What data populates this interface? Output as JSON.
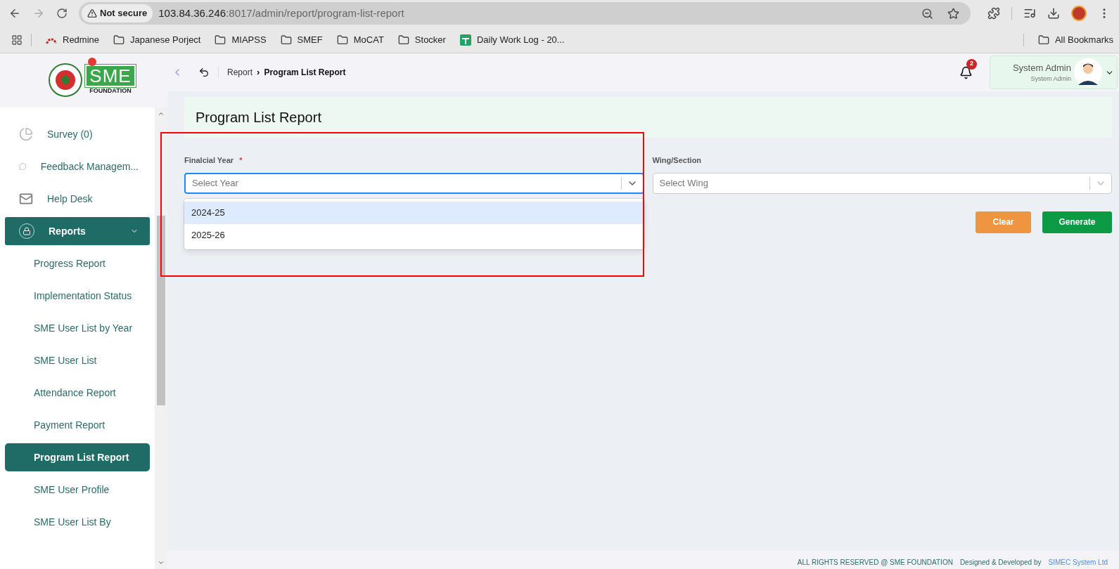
{
  "browser": {
    "security": "Not secure",
    "url_host": "103.84.36.246",
    "url_rest": ":8017/admin/report/program-list-report",
    "bookmarks": [
      {
        "label": "Redmine",
        "kind": "redmine"
      },
      {
        "label": "Japanese Porject",
        "kind": "folder"
      },
      {
        "label": "MIAPSS",
        "kind": "folder"
      },
      {
        "label": "SMEF",
        "kind": "folder"
      },
      {
        "label": "MoCAT",
        "kind": "folder"
      },
      {
        "label": "Stocker",
        "kind": "folder"
      },
      {
        "label": "Daily Work Log - 20...",
        "kind": "sheet"
      }
    ],
    "all_bookmarks": "All Bookmarks"
  },
  "logo": {
    "letters": "SME",
    "subtitle": "FOUNDATION"
  },
  "breadcrumb": {
    "parent": "Report",
    "separator": "›",
    "current": "Program List Report"
  },
  "notifications": {
    "count": "2"
  },
  "user": {
    "name": "System Admin",
    "role": "System Admin"
  },
  "sidebar": {
    "items": [
      {
        "label": "Survey (0)",
        "selected": false
      },
      {
        "label": "Feedback Managem...",
        "selected": false
      },
      {
        "label": "Help Desk",
        "selected": false
      },
      {
        "label": "Reports",
        "selected": true,
        "expanded": true,
        "children": [
          {
            "label": "Progress Report",
            "selected": false
          },
          {
            "label": "Implementation Status",
            "selected": false
          },
          {
            "label": "SME User List by Year",
            "selected": false
          },
          {
            "label": "SME User List",
            "selected": false
          },
          {
            "label": "Attendance Report",
            "selected": false
          },
          {
            "label": "Payment Report",
            "selected": false
          },
          {
            "label": "Program List Report",
            "selected": true
          },
          {
            "label": "SME User Profile",
            "selected": false
          },
          {
            "label": "SME User List By",
            "selected": false
          }
        ]
      }
    ]
  },
  "page": {
    "title": "Program List Report",
    "year_field": {
      "label": "Finalcial Year",
      "required": "*",
      "placeholder": "Select Year",
      "focused": true,
      "options": [
        {
          "label": "2024-25",
          "selected": true
        },
        {
          "label": "2025-26",
          "selected": false
        }
      ]
    },
    "wing_field": {
      "label": "Wing/Section",
      "placeholder": "Select Wing"
    },
    "buttons": [
      {
        "label": "Clear",
        "kind": "clear"
      },
      {
        "label": "Generate",
        "kind": "generate"
      }
    ]
  },
  "footer": {
    "rights": "ALL RIGHTS RESERVED @ SME FOUNDATION",
    "designed": "Designed & Developed by",
    "company": "SIMEC System Ltd"
  }
}
